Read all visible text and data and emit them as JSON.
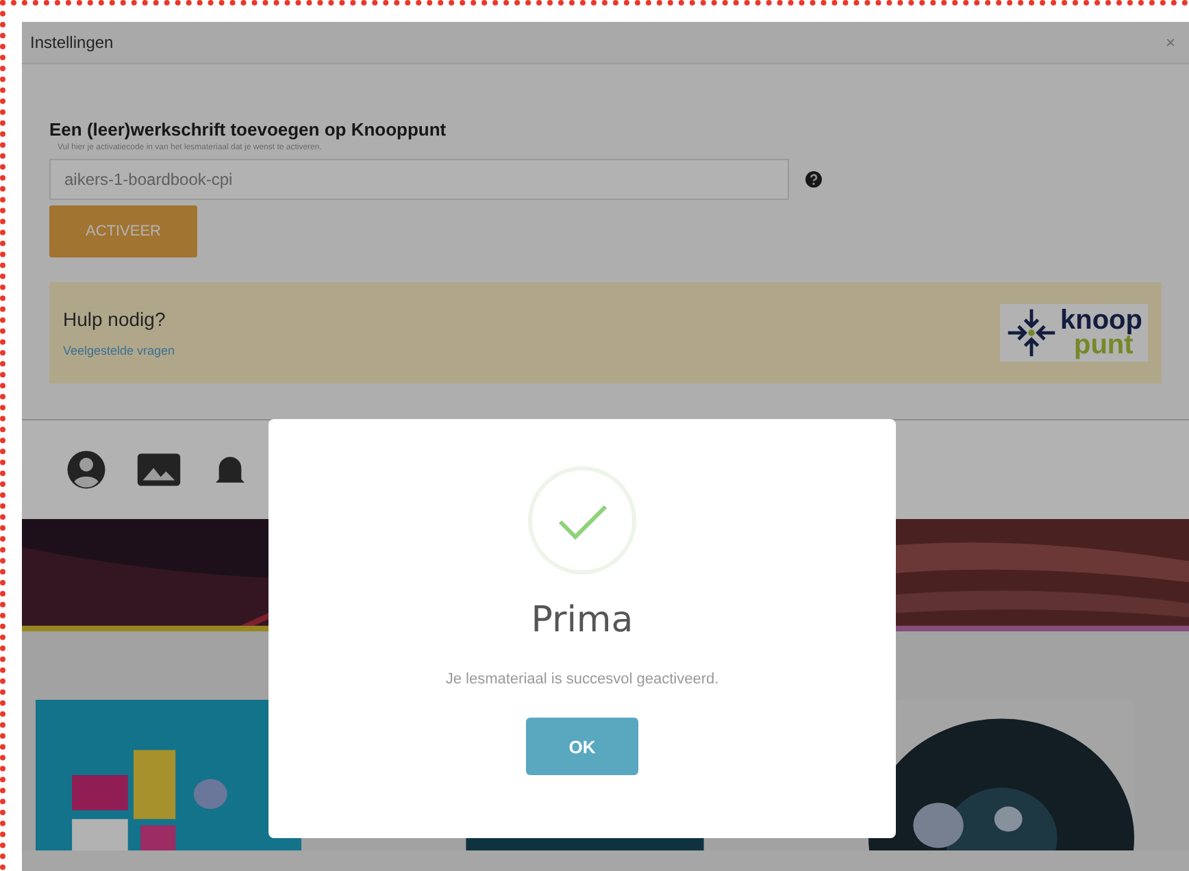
{
  "window": {
    "title": "Instellingen",
    "close": "×"
  },
  "form": {
    "heading": "Een (leer)werkschrift toevoegen op Knooppunt",
    "hint": "Vul hier je activatiecode in van het lesmateriaal dat je wenst te activeren.",
    "code": "aikers-1-boardbook-cpi",
    "button": "ACTIVEER"
  },
  "help": {
    "title": "Hulp nodig?",
    "link": "Veelgestelde vragen"
  },
  "logo": {
    "top": "knoop",
    "bottom": "punt"
  },
  "dialog": {
    "title": "Prima",
    "message": "Je lesmateriaal is succesvol geactiveerd.",
    "button": "OK"
  }
}
